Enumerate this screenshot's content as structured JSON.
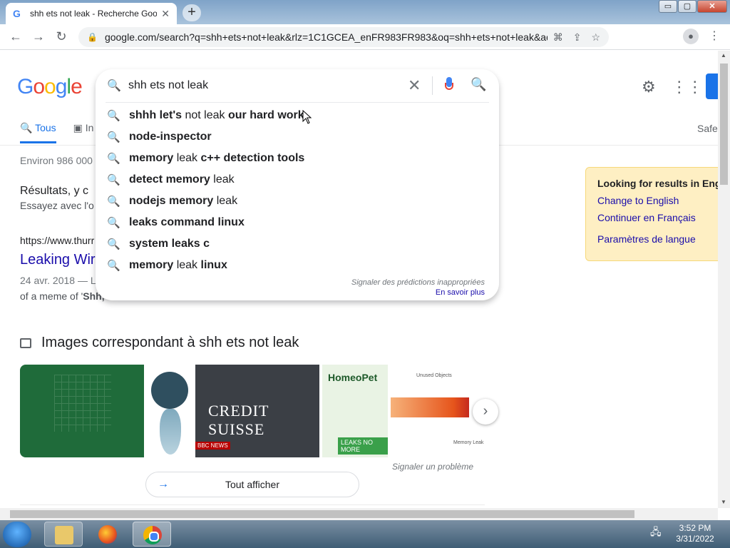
{
  "browser": {
    "tab_title": "shh ets not leak - Recherche Goo",
    "tab_favicon": "G",
    "new_tab": "+",
    "url": "google.com/search?q=shh+ets+not+leak&rlz=1C1GCEA_enFR983FR983&oq=shh+ets+not+leak&aqs=chrome...."
  },
  "window_buttons": {
    "minimize": "▭",
    "maximize": "▢",
    "close": "✕"
  },
  "nav": {
    "back": "←",
    "forward": "→",
    "reload": "↻"
  },
  "google": {
    "logo_letters": [
      "G",
      "o",
      "o",
      "g",
      "l",
      "e"
    ],
    "query": "shh ets not leak",
    "tabs": [
      {
        "label": "Tous",
        "icon": "🔍"
      },
      {
        "label": "In",
        "icon": "▣"
      }
    ],
    "safe": "Safe",
    "stats": "Environ 986 000",
    "results_head": "Résultats, y c",
    "results_sub": "Essayez avec l'o",
    "result": {
      "cite": "https://www.thurr",
      "title": "Leaking Wir",
      "date": "24 avr. 2018 — L",
      "snippet_pre": "of a meme of '",
      "snippet_bold": "Shh,"
    },
    "lang_box": {
      "heading": "Looking for results in Engli",
      "link1": "Change to English",
      "link2": "Continuer en Français",
      "link3": "Paramètres de langue"
    },
    "images_heading": "Images correspondant à shh ets not leak",
    "thumb_texts": {
      "credit_suisse": "CREDIT SUISSE",
      "bbc": "BBC NEWS",
      "homeopet": "HomeoPet",
      "leaks": "LEAKS NO MORE",
      "unused": "Unused Objects",
      "memleak": "Memory Leak"
    },
    "report_problem": "Signaler un problème",
    "see_all": "Tout afficher"
  },
  "suggestions": [
    {
      "bold1": "shhh let's",
      "normal": " not leak ",
      "bold2": "our hard work"
    },
    {
      "bold1": "node-inspector",
      "normal": "",
      "bold2": ""
    },
    {
      "bold1": "memory",
      "normal": " leak ",
      "bold2": "c++ detection tools"
    },
    {
      "bold1": "detect memory",
      "normal": " leak",
      "bold2": ""
    },
    {
      "bold1": "nodejs memory",
      "normal": " leak",
      "bold2": ""
    },
    {
      "bold1": "leaks command linux",
      "normal": "",
      "bold2": ""
    },
    {
      "bold1": "system leaks c",
      "normal": "",
      "bold2": ""
    },
    {
      "bold1": "memory",
      "normal": " leak ",
      "bold2": "linux"
    }
  ],
  "suggest_footer": {
    "report": "Signaler des prédictions inappropriées",
    "learn_more": "En savoir plus"
  },
  "taskbar": {
    "time": "3:52 PM",
    "date": "3/31/2022"
  },
  "colors": {
    "link": "#1a0dab",
    "accent": "#1a73e8",
    "lang_box_bg": "#feefc3"
  }
}
